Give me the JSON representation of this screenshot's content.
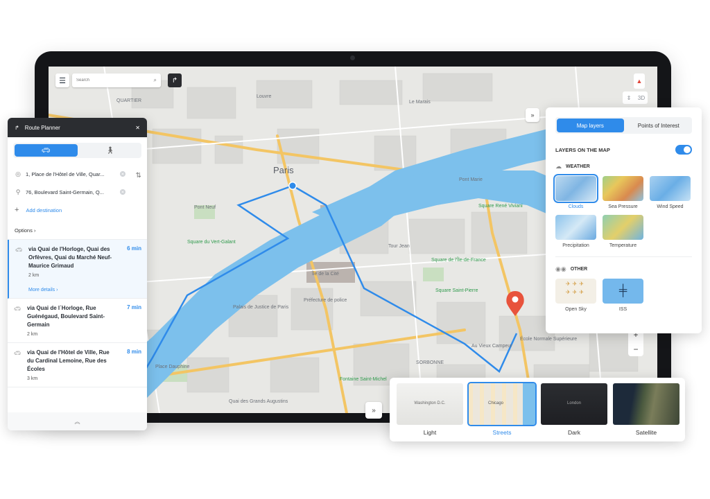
{
  "search": {
    "placeholder": "Search"
  },
  "map": {
    "city_label": "Paris",
    "labels": [
      {
        "text": "QUARTIER",
        "cls": ""
      },
      {
        "text": "Louvre",
        "cls": ""
      },
      {
        "text": "Le Marais",
        "cls": ""
      },
      {
        "text": "Pont Marie",
        "cls": ""
      },
      {
        "text": "Square René Viviani",
        "cls": "green"
      },
      {
        "text": "Préfecture de police",
        "cls": ""
      },
      {
        "text": "Square Saint-Pierre",
        "cls": "green"
      },
      {
        "text": "École Normale Supérieure",
        "cls": ""
      },
      {
        "text": "Place Dauphine",
        "cls": ""
      },
      {
        "text": "Fontaine Saint-Michel",
        "cls": "green"
      },
      {
        "text": "Quai des Grands Augustins",
        "cls": ""
      },
      {
        "text": "Palais de Justice de Paris",
        "cls": ""
      },
      {
        "text": "Île de la Cité",
        "cls": ""
      },
      {
        "text": "Square de l'Île-de-France",
        "cls": "green"
      },
      {
        "text": "Pont Neuf",
        "cls": ""
      },
      {
        "text": "Square du Vert-Galant",
        "cls": "green"
      },
      {
        "text": "Tour Jean",
        "cls": ""
      },
      {
        "text": "SORBONNE",
        "cls": ""
      },
      {
        "text": "Au Vieux Campeur",
        "cls": ""
      }
    ],
    "d3_label": "3D"
  },
  "planner": {
    "title": "Route Planner",
    "from": "1, Place de l'Hôtel de Ville, Quar...",
    "to": "76, Boulevard Saint-Germain, Q...",
    "add_destination": "Add destination",
    "options": "Options",
    "routes": [
      {
        "name": "via Quai de l'Horloge, Quai des Orfèvres, Quai du Marché Neuf-Maurice Grimaud",
        "time": "6 min",
        "dist": "2 km",
        "more": "More details"
      },
      {
        "name": "via Quai de l´Horloge, Rue Guénégaud, Boulevard Saint-Germain",
        "time": "7 min",
        "dist": "2 km"
      },
      {
        "name": "via Quai de l'Hôtel de Ville, Rue du Cardinal Lemoine, Rue des Écoles",
        "time": "8 min",
        "dist": "3 km"
      }
    ]
  },
  "layers": {
    "tabs": [
      "Map layers",
      "Points of Interest"
    ],
    "on_map": "LAYERS ON THE MAP",
    "weather_title": "WEATHER",
    "weather": [
      "Clouds",
      "Sea Pressure",
      "Wind Speed",
      "Precipitation",
      "Temperature"
    ],
    "other_title": "OTHER",
    "other": [
      "Open Sky",
      "ISS"
    ]
  },
  "styles": [
    {
      "label": "Light",
      "thumb_text": "Washington D.C."
    },
    {
      "label": "Streets",
      "thumb_text": "Chicago"
    },
    {
      "label": "Dark",
      "thumb_text": "London"
    },
    {
      "label": "Satellite",
      "thumb_text": ""
    }
  ],
  "colors": {
    "accent": "#2f8bea",
    "water": "#7cc0ec",
    "route": "#2f8bea",
    "marker": "#e8533c"
  }
}
